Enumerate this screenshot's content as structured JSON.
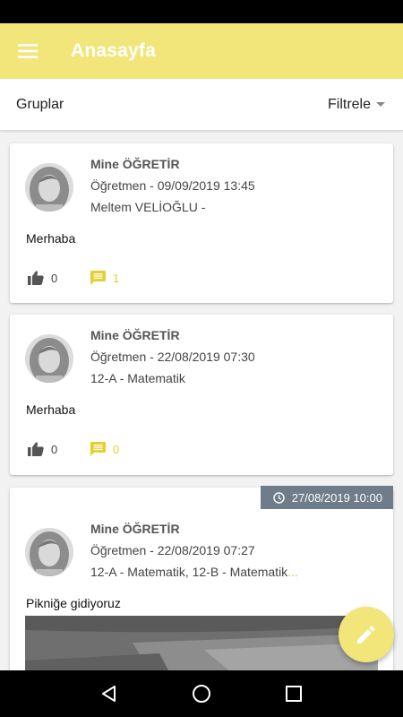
{
  "app_bar": {
    "title": "Anasayfa",
    "menu_icon": "menu-icon",
    "background": "#f2e57a"
  },
  "filter_bar": {
    "groups_label": "Gruplar",
    "filter_label": "Filtrele"
  },
  "posts": [
    {
      "author": "Mine ÖĞRETİR",
      "meta": "Öğretmen - 09/09/2019 13:45",
      "groups": "Meltem VELİOĞLU -",
      "body": "Merhaba",
      "likes": "0",
      "comments": "1"
    },
    {
      "author": "Mine ÖĞRETİR",
      "meta": "Öğretmen - 22/08/2019 07:30",
      "groups": "12-A - Matematik",
      "body": "Merhaba",
      "likes": "0",
      "comments": "0"
    },
    {
      "author": "Mine ÖĞRETİR",
      "meta": "Öğretmen - 22/08/2019 07:27",
      "groups": "12-A - Matematik, 12-B - Matematik",
      "groups_more": "...",
      "body": "Pikniğe gidiyoruz",
      "scheduled_date": "27/08/2019 10:00"
    }
  ],
  "fab": {
    "icon": "pencil-icon"
  },
  "colors": {
    "accent": "#f2e57a",
    "comment_accent": "#e5cf2e",
    "badge": "#6f7c89"
  }
}
